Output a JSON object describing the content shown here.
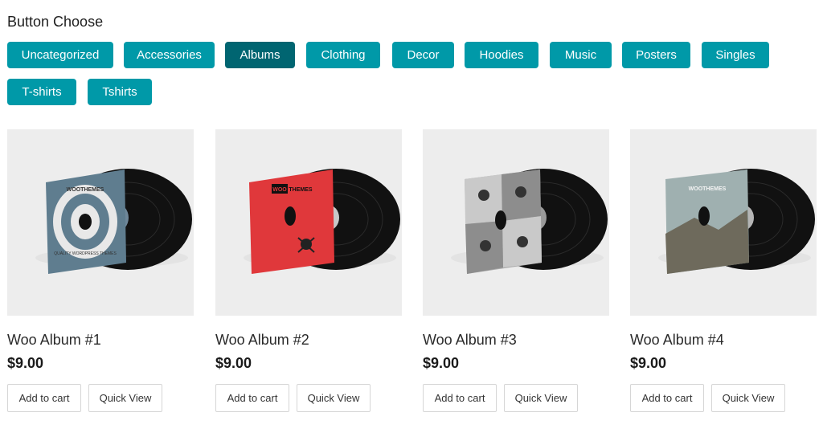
{
  "page": {
    "title": "Button Choose"
  },
  "filters": {
    "row1": [
      "Uncategorized",
      "Accessories",
      "Albums",
      "Clothing",
      "Decor",
      "Hoodies",
      "Music",
      "Posters",
      "Singles"
    ],
    "row2": [
      "T-shirts",
      "Tshirts"
    ],
    "active": "Albums"
  },
  "colors": {
    "button": "#0099a8",
    "button_active": "#006571"
  },
  "products": [
    {
      "title": "Woo Album #1",
      "price": "$9.00",
      "cart_label": "Add to cart",
      "quick_view_label": "Quick View"
    },
    {
      "title": "Woo Album #2",
      "price": "$9.00",
      "cart_label": "Add to cart",
      "quick_view_label": "Quick View"
    },
    {
      "title": "Woo Album #3",
      "price": "$9.00",
      "cart_label": "Add to cart",
      "quick_view_label": "Quick View"
    },
    {
      "title": "Woo Album #4",
      "price": "$9.00",
      "cart_label": "Add to cart",
      "quick_view_label": "Quick View"
    }
  ],
  "album_art": {
    "a1_ring_top": "WOOTHEMES",
    "a1_ring_bottom": "QUALITY WORDPRESS THEMES",
    "a2_logo_left": "WOO",
    "a2_logo_right": "THEMES",
    "a4_text": "WOOTHEMES"
  }
}
